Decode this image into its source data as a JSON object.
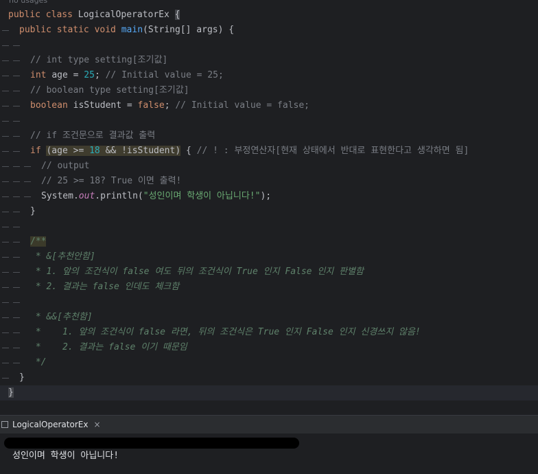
{
  "editor": {
    "usages_hint": "no usages",
    "lines": [
      {
        "html": "<span class='kw'>public class </span><span class='cls'>LogicalOperatorEx </span><span class='brace-hl'>{</span>",
        "depth": 0
      },
      {
        "html": "<span class='kw'>public static void </span><span class='fn'>main</span>(String[] args) {",
        "depth": 1
      },
      {
        "html": "",
        "depth": 2
      },
      {
        "html": "<span class='cm'>// int type setting[조기값]</span>",
        "depth": 2
      },
      {
        "html": "<span class='kw'>int </span>age = <span class='num'>25</span>; <span class='cm'>// Initial value = 25;</span>",
        "depth": 2
      },
      {
        "html": "<span class='cm'>// boolean type setting[조기값]</span>",
        "depth": 2
      },
      {
        "html": "<span class='kw'>boolean </span>isStudent = <span class='kw'>false</span>; <span class='cm'>// Initial value = false;</span>",
        "depth": 2
      },
      {
        "html": "",
        "depth": 2
      },
      {
        "html": "<span class='cm'>// if 조건문으로 결과값 출력</span>",
        "depth": 2
      },
      {
        "html": "<span class='kw'>if </span><span class='hlwarn'>(age &gt;= <span class='num'>18</span> &amp;&amp; !isStudent)</span> { <span class='cm'>// ! : 부정연산자[현재 상태에서 반대로 표현한다고 생각하면 됨]</span>",
        "depth": 2
      },
      {
        "html": "<span class='cm'>// output</span>",
        "depth": 3
      },
      {
        "html": "<span class='cm'>// 25 &gt;= 18? True 이면 출력!</span>",
        "depth": 3
      },
      {
        "html": "System.<span class='static'>out</span>.println(<span class='str'>\"성인이며 학생이 아닙니다!\"</span>);",
        "depth": 3
      },
      {
        "html": "}",
        "depth": 2
      },
      {
        "html": "",
        "depth": 2
      },
      {
        "html": "<span class='docb'>/**</span>",
        "depth": 2
      },
      {
        "html": "<span class='doc'> * &amp;[추천안함]</span>",
        "depth": 2
      },
      {
        "html": "<span class='doc'> * 1. 앞의 조건식이 false 여도 뒤의 조건식이 True 인지 False 인지 판별함</span>",
        "depth": 2
      },
      {
        "html": "<span class='doc'> * 2. 결과는 false 인데도 체크함</span>",
        "depth": 2
      },
      {
        "html": "",
        "depth": 2
      },
      {
        "html": "<span class='doc'> * &amp;&amp;[추천함]</span>",
        "depth": 2
      },
      {
        "html": "<span class='doc'> *    1. 앞의 조건식이 false 라면, 뒤의 조건식은 True 인지 False 인지 신경쓰지 않음!</span>",
        "depth": 2
      },
      {
        "html": "<span class='doc'> *    2. 결과는 false 이기 때문임</span>",
        "depth": 2
      },
      {
        "html": "<span class='doc'> */</span>",
        "depth": 2
      },
      {
        "html": "}",
        "depth": 1
      },
      {
        "html": "<span class='brace-hl'>}</span>",
        "depth": 0
      }
    ]
  },
  "run_panel": {
    "tab_label": "LogicalOperatorEx",
    "close_label": "×",
    "console_output": "성인이며 학생이 아닙니다!"
  }
}
